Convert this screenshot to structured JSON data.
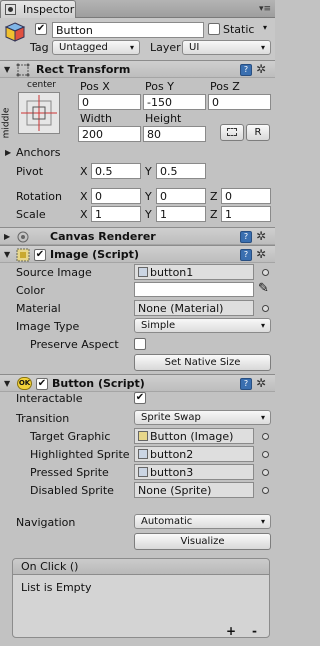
{
  "tab": {
    "title": "Inspector"
  },
  "gameobject": {
    "active": true,
    "name": "Button",
    "static_label": "Static",
    "static_checked": false,
    "tag_label": "Tag",
    "tag_value": "Untagged",
    "layer_label": "Layer",
    "layer_value": "UI"
  },
  "rect_transform": {
    "title": "Rect Transform",
    "anchor_preset_top": "center",
    "anchor_preset_side": "middle",
    "pos_x_label": "Pos X",
    "pos_y_label": "Pos Y",
    "pos_z_label": "Pos Z",
    "pos_x": "0",
    "pos_y": "-150",
    "pos_z": "0",
    "width_label": "Width",
    "height_label": "Height",
    "width": "200",
    "height": "80",
    "raw_edit_button": "R",
    "anchors_label": "Anchors",
    "pivot_label": "Pivot",
    "pivot_x": "0.5",
    "pivot_y": "0.5",
    "rotation_label": "Rotation",
    "rotation_x": "0",
    "rotation_y": "0",
    "rotation_z": "0",
    "scale_label": "Scale",
    "scale_x": "1",
    "scale_y": "1",
    "scale_z": "1",
    "axis_x": "X",
    "axis_y": "Y",
    "axis_z": "Z"
  },
  "canvas_renderer": {
    "title": "Canvas Renderer"
  },
  "image_script": {
    "title": "Image (Script)",
    "enabled": true,
    "source_image_label": "Source Image",
    "source_image_value": "button1",
    "color_label": "Color",
    "material_label": "Material",
    "material_value": "None (Material)",
    "image_type_label": "Image Type",
    "image_type_value": "Simple",
    "preserve_aspect_label": "Preserve Aspect",
    "preserve_aspect_checked": false,
    "set_native_size_button": "Set Native Size"
  },
  "button_script": {
    "title": "Button (Script)",
    "enabled": true,
    "icon_text": "OK",
    "interactable_label": "Interactable",
    "interactable_checked": true,
    "transition_label": "Transition",
    "transition_value": "Sprite Swap",
    "target_graphic_label": "Target Graphic",
    "target_graphic_value": "Button (Image)",
    "highlighted_sprite_label": "Highlighted Sprite",
    "highlighted_sprite_value": "button2",
    "pressed_sprite_label": "Pressed Sprite",
    "pressed_sprite_value": "button3",
    "disabled_sprite_label": "Disabled Sprite",
    "disabled_sprite_value": "None (Sprite)",
    "navigation_label": "Navigation",
    "navigation_value": "Automatic",
    "visualize_button": "Visualize",
    "onclick_title": "On Click ()",
    "onclick_empty": "List is Empty",
    "add_button": "+",
    "remove_button": "-"
  }
}
